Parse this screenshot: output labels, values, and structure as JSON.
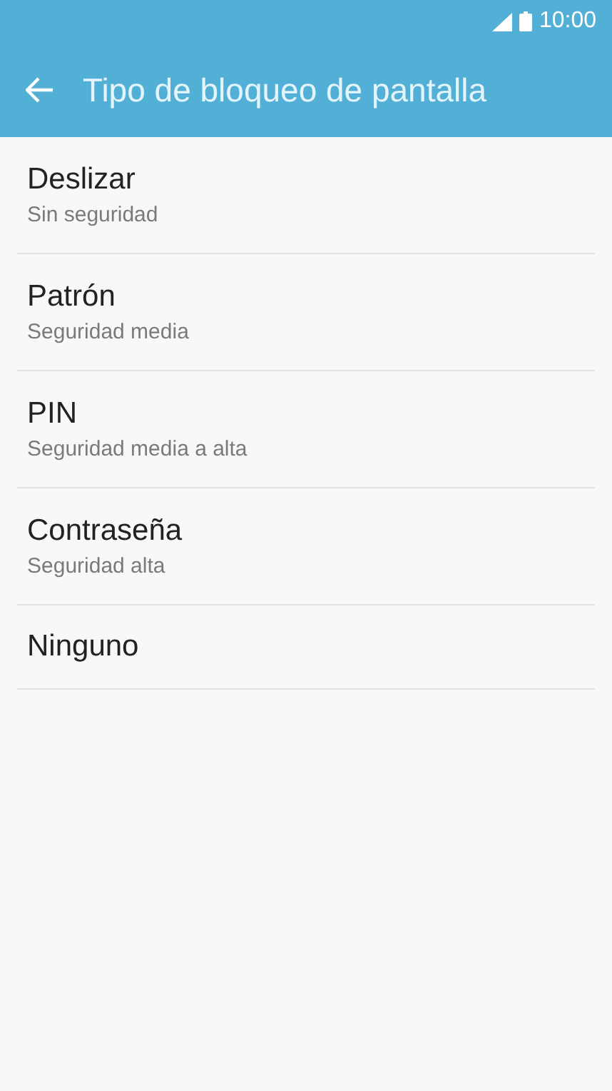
{
  "status_bar": {
    "time": "10:00"
  },
  "app_bar": {
    "title": "Tipo de bloqueo de pantalla"
  },
  "options": [
    {
      "title": "Deslizar",
      "subtitle": "Sin seguridad"
    },
    {
      "title": "Patrón",
      "subtitle": "Seguridad media"
    },
    {
      "title": "PIN",
      "subtitle": "Seguridad media a alta"
    },
    {
      "title": "Contraseña",
      "subtitle": "Seguridad alta"
    },
    {
      "title": "Ninguno"
    }
  ]
}
